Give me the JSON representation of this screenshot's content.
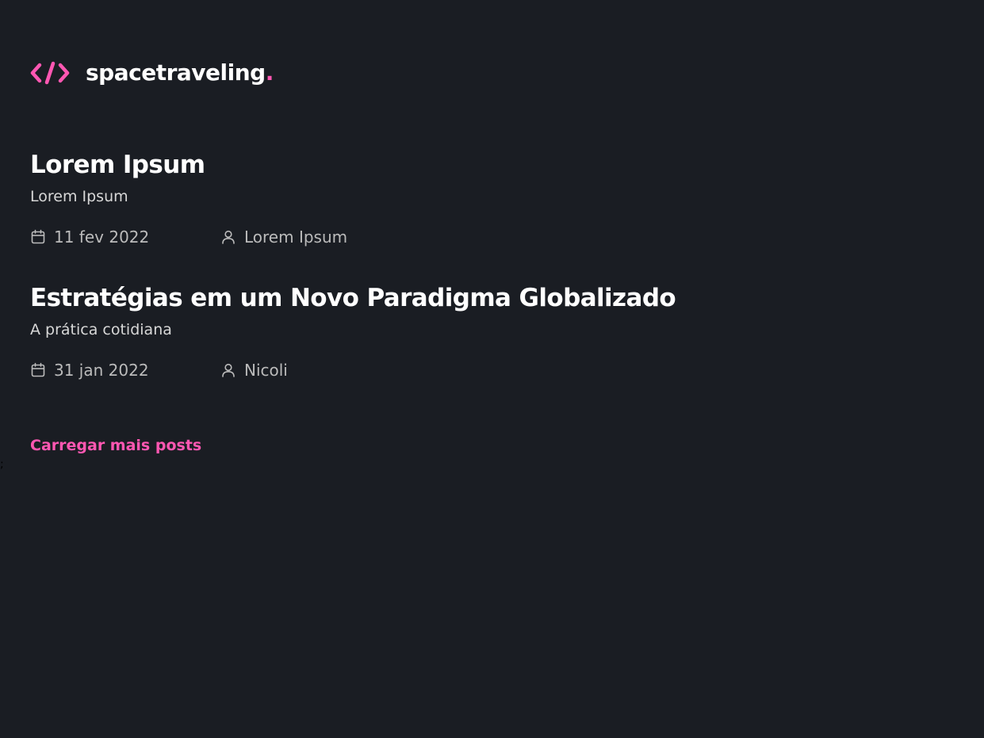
{
  "header": {
    "logo_icon": "code-brackets-icon",
    "brand_name": "spacetraveling",
    "brand_dot": ".",
    "accent_color": "#ff57b2"
  },
  "posts": [
    {
      "title": "Lorem Ipsum",
      "subtitle": "Lorem Ipsum",
      "date": "11 fev 2022",
      "author": "Lorem Ipsum"
    },
    {
      "title": "Estratégias em um Novo Paradigma Globalizado",
      "subtitle": "A prática cotidiana",
      "date": "31 jan 2022",
      "author": "Nicoli"
    }
  ],
  "icons": {
    "date": "calendar-icon",
    "author": "user-icon"
  },
  "load_more_label": "Carregar mais posts",
  "stray_text": ";",
  "colors": {
    "background": "#1a1d23",
    "heading": "#ffffff",
    "body_text": "#d7d7d7",
    "meta_text": "#bbbbbb"
  }
}
